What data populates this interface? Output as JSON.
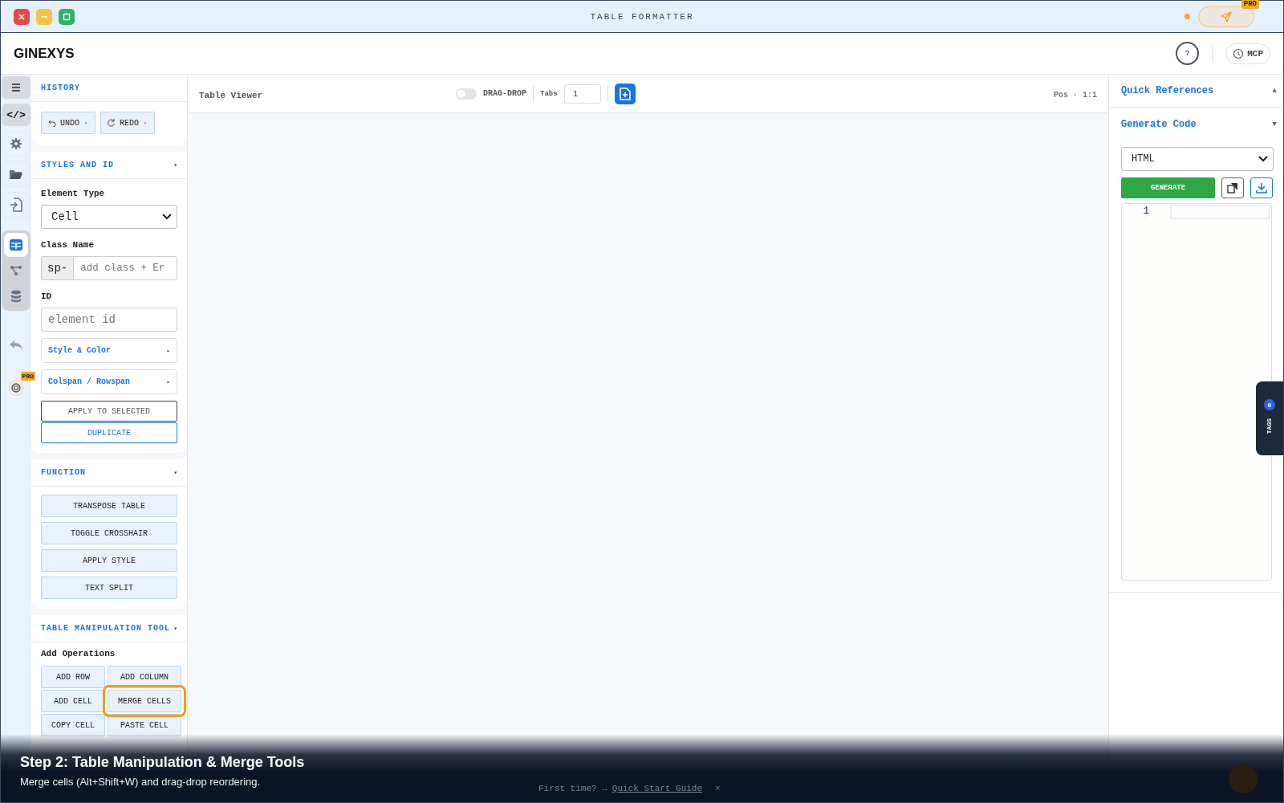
{
  "window": {
    "title": "TABLE FORMATTER",
    "pro_badge": "PRO"
  },
  "header": {
    "logo": "GINEXYS",
    "help": "?",
    "mcp": "MCP"
  },
  "rail": {
    "items": [
      {
        "selected": true
      },
      {
        "label": "</>",
        "selected": true
      },
      {
        "selected": false
      },
      {
        "selected": false
      },
      {
        "selected": false
      }
    ],
    "group": [
      {
        "selected": true
      },
      {
        "selected": false
      },
      {
        "selected": false
      }
    ],
    "pro_badge": "PRO"
  },
  "sidebar": {
    "history": {
      "title": "HISTORY",
      "buttons": [
        {
          "label": "UNDO",
          "dot": "·"
        },
        {
          "label": "REDO",
          "dot": "·"
        }
      ]
    },
    "styles": {
      "title": "STYLES AND ID",
      "arrow": "▾",
      "element_type_label": "Element Type",
      "element_type": "Cell",
      "class_label": "Class Name",
      "class_prefix": "sp-",
      "class_placeholder": "add class + Er",
      "id_label": "ID",
      "id_placeholder": "element id",
      "collapsibles": [
        {
          "label": "Style & Color",
          "arrow": "▸"
        },
        {
          "label": "Colspan / Rowspan",
          "arrow": "▸"
        }
      ],
      "apply": "APPLY TO SELECTED",
      "duplicate": "DUPLICATE"
    },
    "function": {
      "title": "FUNCTION",
      "arrow": "▾",
      "buttons": [
        "TRANSPOSE TABLE",
        "TOGGLE CROSSHAIR",
        "APPLY STYLE",
        "TEXT SPLIT"
      ]
    },
    "table_tool": {
      "title": "TABLE MANIPULATION TOOL",
      "arrow": "▾",
      "subtitle": "Add Operations",
      "buttons": [
        {
          "label": "ADD ROW",
          "highlighted": false
        },
        {
          "label": "ADD COLUMN",
          "highlighted": false
        },
        {
          "label": "ADD CELL",
          "highlighted": false
        },
        {
          "label": "MERGE CELLS",
          "highlighted": true
        },
        {
          "label": "COPY CELL",
          "highlighted": false
        },
        {
          "label": "PASTE CELL",
          "highlighted": false
        }
      ]
    }
  },
  "viewer": {
    "title": "Table Viewer",
    "drag_drop": {
      "label": "DRAG-DROP",
      "on": false
    },
    "tabs_label": "Tabs",
    "tabs_value": "1",
    "position": "Pos · 1:1"
  },
  "right_panel": {
    "quick_references": {
      "title": "Quick References",
      "arrow": "▲"
    },
    "generate_code": {
      "title": "Generate Code",
      "arrow": "▼",
      "language": "HTML",
      "generate": "GENERATE",
      "line_numbers": [
        "1"
      ]
    }
  },
  "tags_tab": {
    "label": "TAGS",
    "count": "0"
  },
  "tour": {
    "title": "Step 2: Table Manipulation & Merge Tools",
    "text": "Merge cells (Alt+Shift+W) and drag-drop reordering.",
    "banner": "First time? → ",
    "banner_link": "Quick Start Guide",
    "banner_close": "×"
  }
}
